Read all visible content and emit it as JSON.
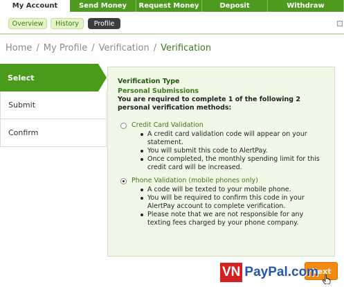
{
  "topnav": {
    "tabs": [
      {
        "label": "My Account"
      },
      {
        "label": "Send Money"
      },
      {
        "label": "Request Money"
      },
      {
        "label": "Deposit"
      },
      {
        "label": "Withdraw"
      }
    ]
  },
  "subnav": {
    "pills": [
      {
        "label": "Overview"
      },
      {
        "label": "History"
      },
      {
        "label": "Profile"
      }
    ]
  },
  "breadcrumb": {
    "items": [
      "Home",
      "My Profile",
      "Verification",
      "Verification"
    ],
    "separator": "/"
  },
  "steps": [
    {
      "label": "Select"
    },
    {
      "label": "Submit"
    },
    {
      "label": "Confirm"
    }
  ],
  "verification": {
    "title": "Verification Type",
    "subtitle": "Personal Submissions",
    "description": "You are required to complete 1 of the following 2 personal verification methods:",
    "options": [
      {
        "label": "Credit Card Validation",
        "checked": false,
        "bullets": [
          "A credit card validation code will appear on your statement.",
          "You will submit this code to AlertPay.",
          "Once completed, the monthly spending limit for this credit card will be increased."
        ]
      },
      {
        "label": "Phone Validation (mobile phones only)",
        "checked": true,
        "bullets": [
          "A code will be texted to your mobile phone.",
          "You will be required to confirm this code in your AlertPay account to complete verification.",
          "Please note that we are not responsible for any texting fees charged by your phone company."
        ]
      }
    ]
  },
  "next_button": {
    "label": "Next"
  },
  "watermark": {
    "part1": "VN",
    "part2": "PayPal.com"
  },
  "colors": {
    "brand_green": "#4a9b1c",
    "accent_orange": "#f28a10"
  }
}
